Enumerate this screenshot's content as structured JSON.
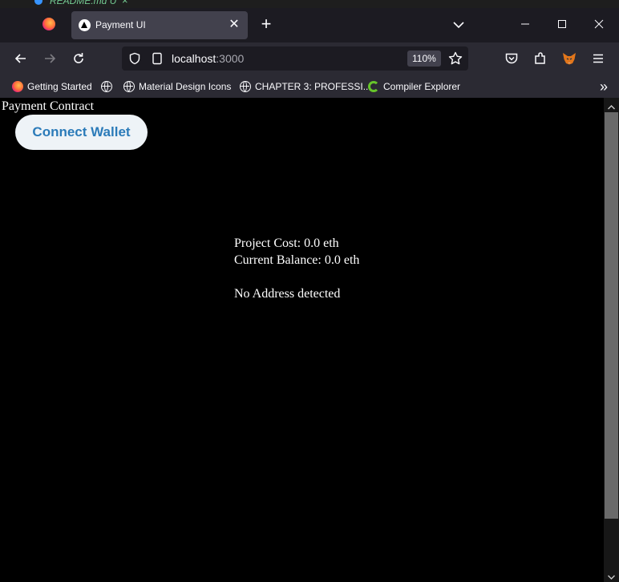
{
  "editor_tab": {
    "filename": "README.md",
    "modified_marker": "U",
    "close_glyph": "×"
  },
  "browser": {
    "tab": {
      "title": "Payment UI",
      "close_glyph": "✕"
    },
    "new_tab_glyph": "+",
    "window_controls": {
      "minimize": "—",
      "maximize": "☐",
      "close": "✕"
    },
    "url": {
      "host": "localhost",
      "port": ":3000"
    },
    "zoom_level": "110%",
    "bookmarks": [
      {
        "label": "Getting Started",
        "icon": "firefox-icon"
      },
      {
        "label": "",
        "icon": "globe-icon"
      },
      {
        "label": "Material Design Icons",
        "icon": "globe-icon"
      },
      {
        "label": "CHAPTER 3: PROFESSI...",
        "icon": "globe-icon"
      },
      {
        "label": "Compiler Explorer",
        "icon": "compiler-explorer-icon"
      }
    ],
    "more_bookmarks_glyph": "»"
  },
  "page": {
    "heading": "Payment Contract",
    "connect_button_label": "Connect Wallet",
    "project_cost": "Project Cost: 0.0 eth",
    "current_balance": "Current Balance: 0.0 eth",
    "address_status": "No Address detected"
  },
  "colors": {
    "page_background": "#000000",
    "page_text": "#ffffff",
    "button_background": "#eef3f7",
    "button_text": "#2b7bb9",
    "browser_chrome": "#2b2a33",
    "tab_active": "#42414d"
  }
}
